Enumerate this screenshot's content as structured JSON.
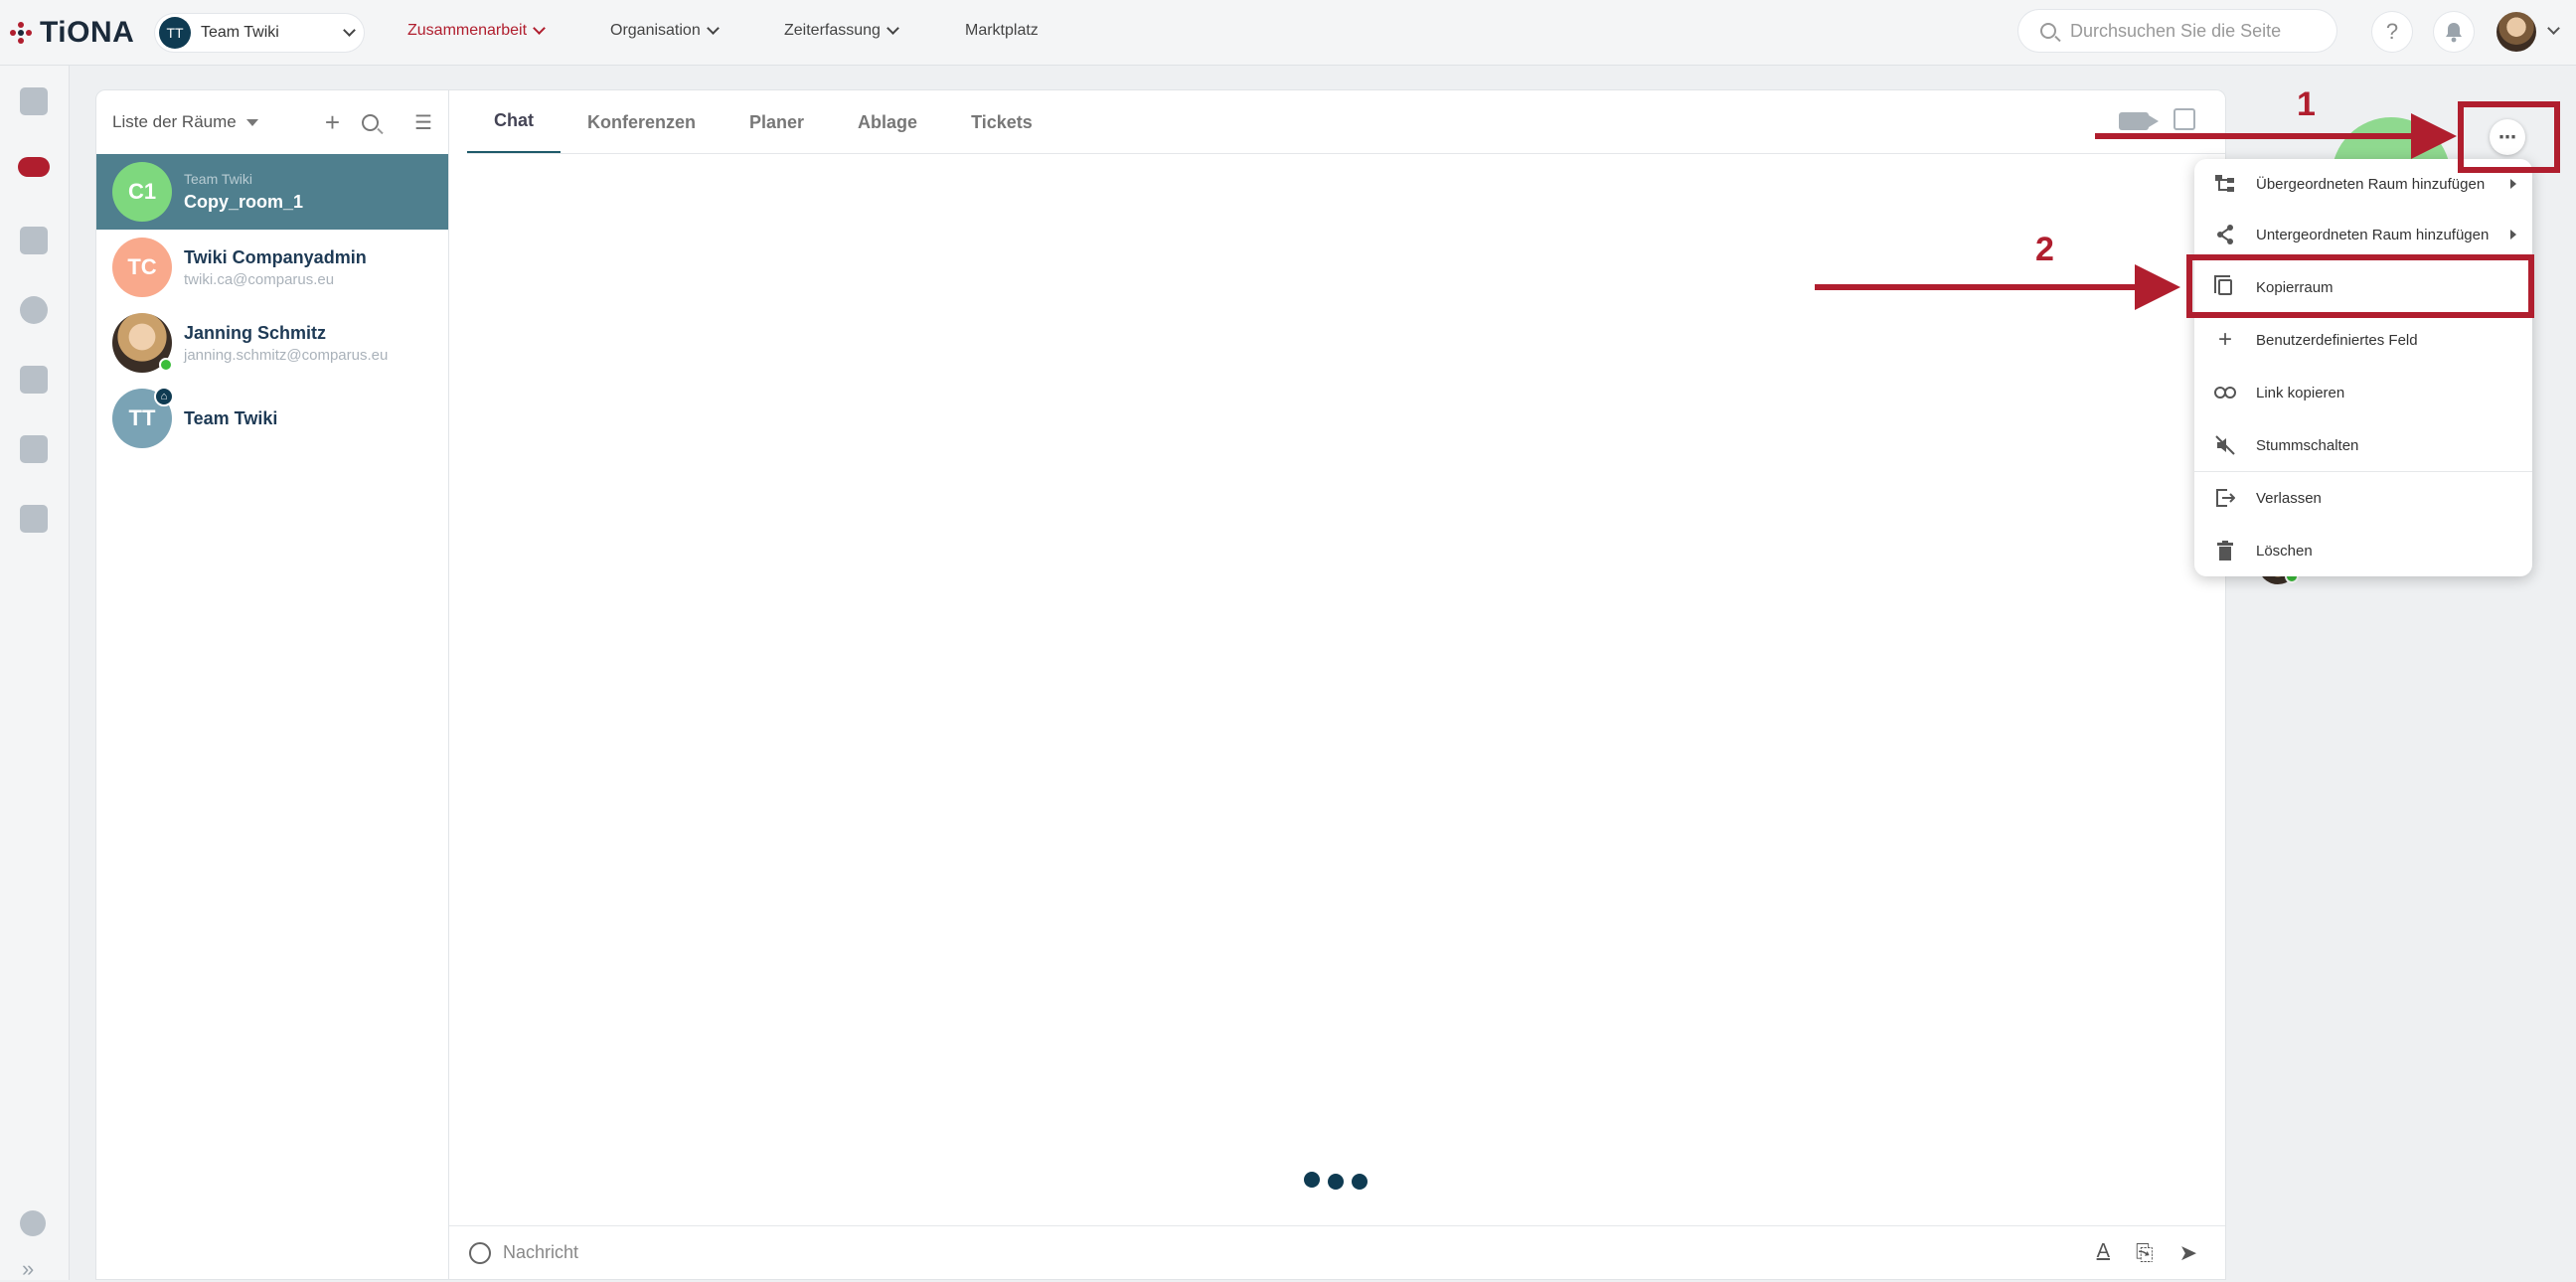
{
  "app": {
    "logo_text": "TiONA"
  },
  "team_select": {
    "initials": "TT",
    "label": "Team Twiki"
  },
  "nav": [
    {
      "label": "Zusammenarbeit",
      "active": true
    },
    {
      "label": "Organisation",
      "active": false
    },
    {
      "label": "Zeiterfassung",
      "active": false
    },
    {
      "label": "Marktplatz",
      "active": false
    }
  ],
  "search": {
    "placeholder": "Durchsuchen Sie die Seite"
  },
  "header": {
    "help_label": "?"
  },
  "rooms": {
    "title": "Liste der Räume",
    "items": [
      {
        "initials": "C1",
        "team": "Team Twiki",
        "name": "Copy_room_1",
        "color": "#7ed87e",
        "selected": true
      },
      {
        "initials": "TC",
        "name": "Twiki Companyadmin",
        "sub": "twiki.ca@comparus.eu",
        "color": "#f9a98c"
      },
      {
        "initials": "",
        "name": "Janning Schmitz",
        "sub": "janning.schmitz@comparus.eu",
        "photo": true,
        "online": true
      },
      {
        "initials": "TT",
        "name": "Team Twiki",
        "color": "#7aa3b5",
        "home": true
      }
    ]
  },
  "tabs": [
    "Chat",
    "Konferenzen",
    "Planer",
    "Ablage",
    "Tickets"
  ],
  "composer": {
    "placeholder": "Nachricht"
  },
  "menu": {
    "items": [
      {
        "label": "Übergeordneten Raum hinzufügen",
        "icon": "tree-icon",
        "submenu": true
      },
      {
        "label": "Untergeordneten Raum hinzufügen",
        "icon": "share-icon",
        "submenu": true
      },
      {
        "label": "Kopierraum",
        "icon": "copy-icon",
        "submenu": false
      },
      {
        "label": "Benutzerdefiniertes Feld",
        "icon": "plus-icon",
        "submenu": false
      },
      {
        "label": "Link kopieren",
        "icon": "link-icon",
        "submenu": false
      },
      {
        "label": "Stummschalten",
        "icon": "mute-icon",
        "submenu": false
      },
      {
        "label": "Verlassen",
        "icon": "exit-icon",
        "submenu": false
      },
      {
        "label": "Löschen",
        "icon": "trash-icon",
        "submenu": false
      }
    ]
  },
  "annotations": {
    "step1": "1",
    "step2": "2",
    "color": "#b01e2e"
  }
}
